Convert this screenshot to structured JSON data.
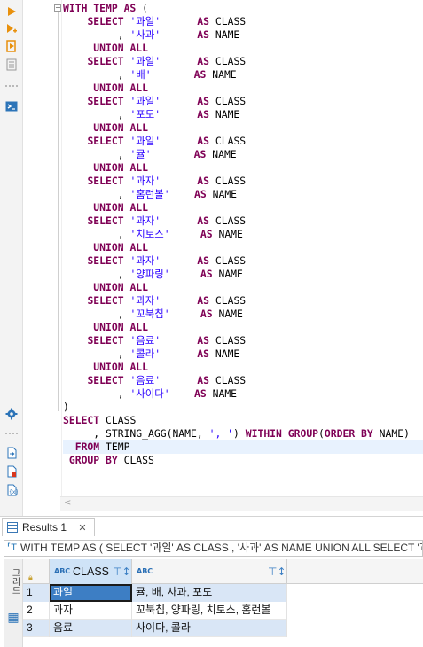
{
  "editor": {
    "lines": [
      [
        {
          "t": "WITH TEMP AS",
          "c": "kw"
        },
        {
          "t": " ("
        }
      ],
      [
        {
          "t": "    "
        },
        {
          "t": "SELECT",
          "c": "kw"
        },
        {
          "t": " "
        },
        {
          "t": "'과일'",
          "c": "str"
        },
        {
          "t": "      "
        },
        {
          "t": "AS",
          "c": "kw"
        },
        {
          "t": " CLASS"
        }
      ],
      [
        {
          "t": "         , "
        },
        {
          "t": "'사과'",
          "c": "str"
        },
        {
          "t": "      "
        },
        {
          "t": "AS",
          "c": "kw"
        },
        {
          "t": " NAME"
        }
      ],
      [
        {
          "t": "     "
        },
        {
          "t": "UNION ALL",
          "c": "kw"
        }
      ],
      [
        {
          "t": "    "
        },
        {
          "t": "SELECT",
          "c": "kw"
        },
        {
          "t": " "
        },
        {
          "t": "'과일'",
          "c": "str"
        },
        {
          "t": "      "
        },
        {
          "t": "AS",
          "c": "kw"
        },
        {
          "t": " CLASS"
        }
      ],
      [
        {
          "t": "         , "
        },
        {
          "t": "'배'",
          "c": "str"
        },
        {
          "t": "       "
        },
        {
          "t": "AS",
          "c": "kw"
        },
        {
          "t": " NAME"
        }
      ],
      [
        {
          "t": "     "
        },
        {
          "t": "UNION ALL",
          "c": "kw"
        }
      ],
      [
        {
          "t": "    "
        },
        {
          "t": "SELECT",
          "c": "kw"
        },
        {
          "t": " "
        },
        {
          "t": "'과일'",
          "c": "str"
        },
        {
          "t": "      "
        },
        {
          "t": "AS",
          "c": "kw"
        },
        {
          "t": " CLASS"
        }
      ],
      [
        {
          "t": "         , "
        },
        {
          "t": "'포도'",
          "c": "str"
        },
        {
          "t": "      "
        },
        {
          "t": "AS",
          "c": "kw"
        },
        {
          "t": " NAME"
        }
      ],
      [
        {
          "t": "     "
        },
        {
          "t": "UNION ALL",
          "c": "kw"
        }
      ],
      [
        {
          "t": "    "
        },
        {
          "t": "SELECT",
          "c": "kw"
        },
        {
          "t": " "
        },
        {
          "t": "'과일'",
          "c": "str"
        },
        {
          "t": "      "
        },
        {
          "t": "AS",
          "c": "kw"
        },
        {
          "t": " CLASS"
        }
      ],
      [
        {
          "t": "         , "
        },
        {
          "t": "'귤'",
          "c": "str"
        },
        {
          "t": "       "
        },
        {
          "t": "AS",
          "c": "kw"
        },
        {
          "t": " NAME"
        }
      ],
      [
        {
          "t": "     "
        },
        {
          "t": "UNION ALL",
          "c": "kw"
        }
      ],
      [
        {
          "t": "    "
        },
        {
          "t": "SELECT",
          "c": "kw"
        },
        {
          "t": " "
        },
        {
          "t": "'과자'",
          "c": "str"
        },
        {
          "t": "      "
        },
        {
          "t": "AS",
          "c": "kw"
        },
        {
          "t": " CLASS"
        }
      ],
      [
        {
          "t": "         , "
        },
        {
          "t": "'홈런볼'",
          "c": "str"
        },
        {
          "t": "    "
        },
        {
          "t": "AS",
          "c": "kw"
        },
        {
          "t": " NAME"
        }
      ],
      [
        {
          "t": "     "
        },
        {
          "t": "UNION ALL",
          "c": "kw"
        }
      ],
      [
        {
          "t": "    "
        },
        {
          "t": "SELECT",
          "c": "kw"
        },
        {
          "t": " "
        },
        {
          "t": "'과자'",
          "c": "str"
        },
        {
          "t": "      "
        },
        {
          "t": "AS",
          "c": "kw"
        },
        {
          "t": " CLASS"
        }
      ],
      [
        {
          "t": "         , "
        },
        {
          "t": "'치토스'",
          "c": "str"
        },
        {
          "t": "     "
        },
        {
          "t": "AS",
          "c": "kw"
        },
        {
          "t": " NAME"
        }
      ],
      [
        {
          "t": "     "
        },
        {
          "t": "UNION ALL",
          "c": "kw"
        }
      ],
      [
        {
          "t": "    "
        },
        {
          "t": "SELECT",
          "c": "kw"
        },
        {
          "t": " "
        },
        {
          "t": "'과자'",
          "c": "str"
        },
        {
          "t": "      "
        },
        {
          "t": "AS",
          "c": "kw"
        },
        {
          "t": " CLASS"
        }
      ],
      [
        {
          "t": "         , "
        },
        {
          "t": "'양파링'",
          "c": "str"
        },
        {
          "t": "     "
        },
        {
          "t": "AS",
          "c": "kw"
        },
        {
          "t": " NAME"
        }
      ],
      [
        {
          "t": "     "
        },
        {
          "t": "UNION ALL",
          "c": "kw"
        }
      ],
      [
        {
          "t": "    "
        },
        {
          "t": "SELECT",
          "c": "kw"
        },
        {
          "t": " "
        },
        {
          "t": "'과자'",
          "c": "str"
        },
        {
          "t": "      "
        },
        {
          "t": "AS",
          "c": "kw"
        },
        {
          "t": " CLASS"
        }
      ],
      [
        {
          "t": "         , "
        },
        {
          "t": "'꼬북칩'",
          "c": "str"
        },
        {
          "t": "     "
        },
        {
          "t": "AS",
          "c": "kw"
        },
        {
          "t": " NAME"
        }
      ],
      [
        {
          "t": "     "
        },
        {
          "t": "UNION ALL",
          "c": "kw"
        }
      ],
      [
        {
          "t": "    "
        },
        {
          "t": "SELECT",
          "c": "kw"
        },
        {
          "t": " "
        },
        {
          "t": "'음료'",
          "c": "str"
        },
        {
          "t": "      "
        },
        {
          "t": "AS",
          "c": "kw"
        },
        {
          "t": " CLASS"
        }
      ],
      [
        {
          "t": "         , "
        },
        {
          "t": "'콜라'",
          "c": "str"
        },
        {
          "t": "      "
        },
        {
          "t": "AS",
          "c": "kw"
        },
        {
          "t": " NAME"
        }
      ],
      [
        {
          "t": "     "
        },
        {
          "t": "UNION ALL",
          "c": "kw"
        }
      ],
      [
        {
          "t": "    "
        },
        {
          "t": "SELECT",
          "c": "kw"
        },
        {
          "t": " "
        },
        {
          "t": "'음료'",
          "c": "str"
        },
        {
          "t": "      "
        },
        {
          "t": "AS",
          "c": "kw"
        },
        {
          "t": " CLASS"
        }
      ],
      [
        {
          "t": "         , "
        },
        {
          "t": "'사이다'",
          "c": "str"
        },
        {
          "t": "    "
        },
        {
          "t": "AS",
          "c": "kw"
        },
        {
          "t": " NAME"
        }
      ],
      [
        {
          "t": ")"
        }
      ],
      [
        {
          "t": "SELECT",
          "c": "kw"
        },
        {
          "t": " CLASS"
        }
      ],
      [
        {
          "t": "     , STRING_AGG(NAME, "
        },
        {
          "t": "', '",
          "c": "str"
        },
        {
          "t": ") "
        },
        {
          "t": "WITHIN GROUP",
          "c": "kw"
        },
        {
          "t": "("
        },
        {
          "t": "ORDER BY",
          "c": "kw"
        },
        {
          "t": " NAME)"
        }
      ],
      [
        {
          "t": "  "
        },
        {
          "t": "FROM",
          "c": "kw"
        },
        {
          "t": " TEMP"
        }
      ],
      [
        {
          "t": " "
        },
        {
          "t": "GROUP BY",
          "c": "kw"
        },
        {
          "t": " CLASS"
        }
      ]
    ],
    "current_line": 33
  },
  "results": {
    "tab_label": "Results 1",
    "close_glyph": "✕",
    "query_text": "WITH TEMP AS ( SELECT '과일' AS CLASS , '사과' AS NAME UNION ALL SELECT '과일' AS CLASS",
    "side_buttons": [
      "그리드",
      "▦"
    ],
    "columns": [
      {
        "type_icon": "ABC",
        "label": "CLASS",
        "selected": true
      },
      {
        "type_icon": "ABC",
        "label": "",
        "selected": false
      }
    ],
    "rows": [
      {
        "num": "1",
        "class": "과일",
        "name": "귤, 배, 사과, 포도"
      },
      {
        "num": "2",
        "class": "과자",
        "name": "꼬북칩, 양파링, 치토스, 홈런볼"
      },
      {
        "num": "3",
        "class": "음료",
        "name": "사이다, 콜라"
      }
    ]
  },
  "colors": {
    "keyword": "#7f0055",
    "string": "#2a00ff",
    "accent": "#3d7ec4",
    "row_alt": "#d9e6f6"
  }
}
